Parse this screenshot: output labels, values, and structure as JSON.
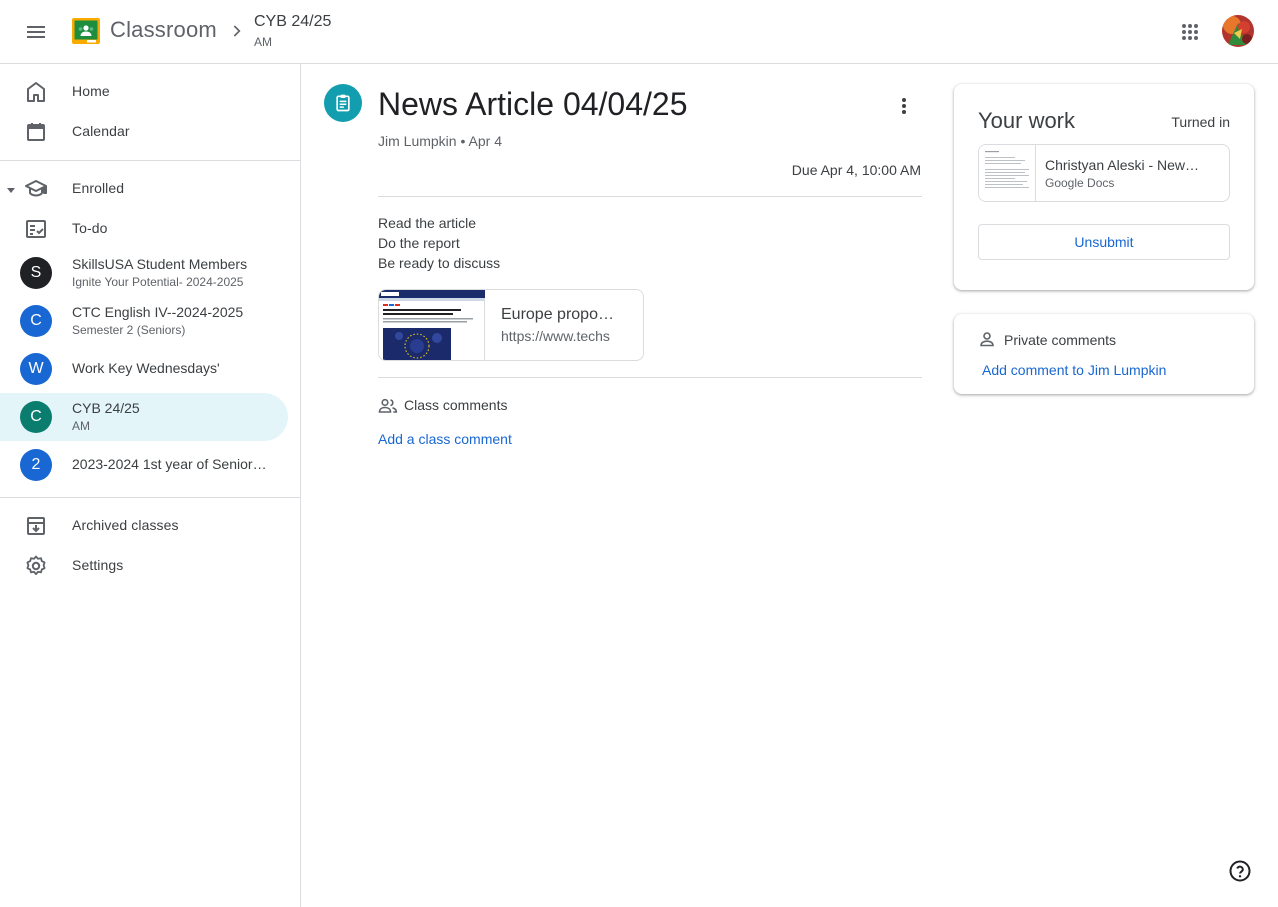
{
  "header": {
    "app_name": "Classroom",
    "class_title": "CYB 24/25",
    "class_section": "AM"
  },
  "sidebar": {
    "home": "Home",
    "calendar": "Calendar",
    "enrolled": "Enrolled",
    "todo": "To-do",
    "classes": [
      {
        "initial": "S",
        "name": "SkillsUSA Student Members",
        "section": "Ignite Your Potential- 2024-2025",
        "color": "#202124"
      },
      {
        "initial": "C",
        "name": "CTC English IV--2024-2025",
        "section": "Semester 2 (Seniors)",
        "color": "#1967d2"
      },
      {
        "initial": "W",
        "name": "Work Key Wednesdays'",
        "section": "",
        "color": "#1967d2"
      },
      {
        "initial": "C",
        "name": "CYB 24/25",
        "section": "AM",
        "color": "#137333"
      },
      {
        "initial": "2",
        "name": "2023-2024 1st year of Senior…",
        "section": "",
        "color": "#1967d2"
      }
    ],
    "archived": "Archived classes",
    "settings": "Settings"
  },
  "assignment": {
    "title": "News Article 04/04/25",
    "author": "Jim Lumpkin",
    "date": "Apr 4",
    "due": "Due Apr 4, 10:00 AM",
    "instructions": [
      "Read the article",
      "Do the report",
      "Be ready to discuss"
    ],
    "attachment": {
      "title": "Europe propo…",
      "url": "https://www.techs"
    },
    "class_comments_label": "Class comments",
    "add_class_comment": "Add a class comment"
  },
  "your_work": {
    "title": "Your work",
    "status": "Turned in",
    "file_name": "Christyan Aleski - New…",
    "file_type": "Google Docs",
    "unsubmit_label": "Unsubmit"
  },
  "private_comments": {
    "label": "Private comments",
    "add_link": "Add comment to Jim Lumpkin"
  },
  "colors": {
    "accent_blue": "#1967d2",
    "assignment_teal": "#129eaf",
    "active_bg": "#e3f5f9"
  }
}
